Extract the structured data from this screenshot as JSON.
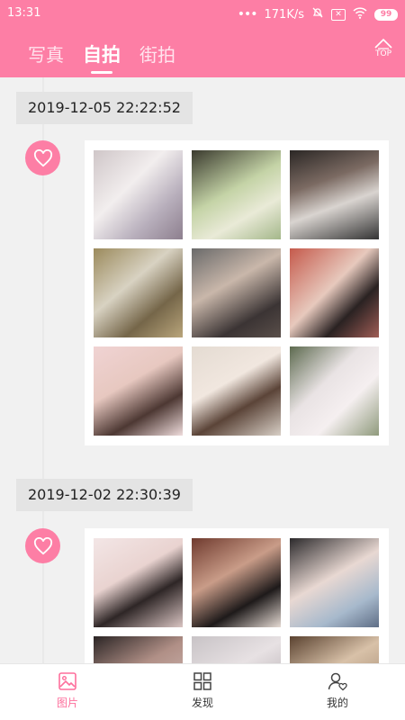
{
  "status": {
    "time": "13:31",
    "speed": "171K/s",
    "battery": "99"
  },
  "tabs": [
    {
      "label": "写真",
      "active": false
    },
    {
      "label": "自拍",
      "active": true
    },
    {
      "label": "街拍",
      "active": false
    }
  ],
  "top_button": {
    "label": "TOP"
  },
  "posts": [
    {
      "date": "2019-12-05 22:22:52",
      "photo_count": 9
    },
    {
      "date": "2019-12-02 22:30:39",
      "photo_count": 6
    }
  ],
  "bottom_nav": [
    {
      "label": "图片",
      "icon": "image-icon",
      "active": true
    },
    {
      "label": "发现",
      "icon": "grid-icon",
      "active": false
    },
    {
      "label": "我的",
      "icon": "person-heart-icon",
      "active": false
    }
  ],
  "colors": {
    "accent": "#fd7ea5",
    "accent_active": "#fd6f9c",
    "background": "#f1f1f1"
  }
}
